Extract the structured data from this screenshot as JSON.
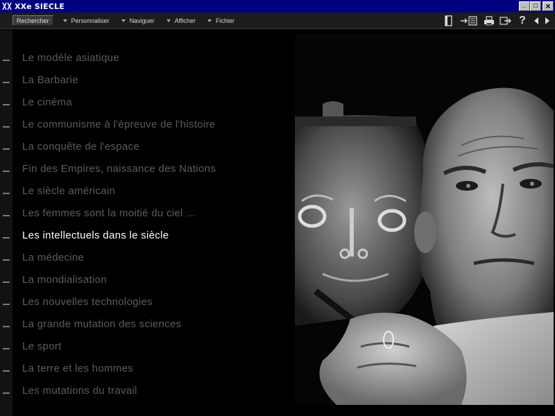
{
  "window": {
    "title": "XXe SIECLE",
    "buttons": {
      "minimize": "_",
      "maximize": "□",
      "close": "×"
    }
  },
  "menubar": {
    "search_label": "Rechercher",
    "items": [
      "Personnaliser",
      "Naviguer",
      "Afficher",
      "Fichier"
    ]
  },
  "toolbar": {
    "icons": [
      "book-icon",
      "arrow-to-book-icon",
      "printer-icon",
      "export-icon",
      "help-icon",
      "previous-icon",
      "next-icon"
    ],
    "help_glyph": "?"
  },
  "topics": {
    "active_index": 8,
    "items": [
      "Le modèle asiatique",
      "La Barbarie",
      "Le cinéma",
      "Le communisme à l'épreuve de l'histoire",
      "La conquête de l'espace",
      "Fin des Empires, naissance des Nations",
      "Le siècle américain",
      "Les femmes sont la moitié du ciel ...",
      "Les intellectuels dans le siècle",
      "La médecine",
      "La mondialisation",
      "Les nouvelles technologies",
      "La grande mutation des sciences",
      "Le sport",
      "La terre et les hommes",
      "Les mutations du travail"
    ]
  },
  "colors": {
    "titlebar": "#000080",
    "topic_inactive": "#5c5c5c",
    "topic_active": "#ffffff",
    "background": "#000000"
  }
}
